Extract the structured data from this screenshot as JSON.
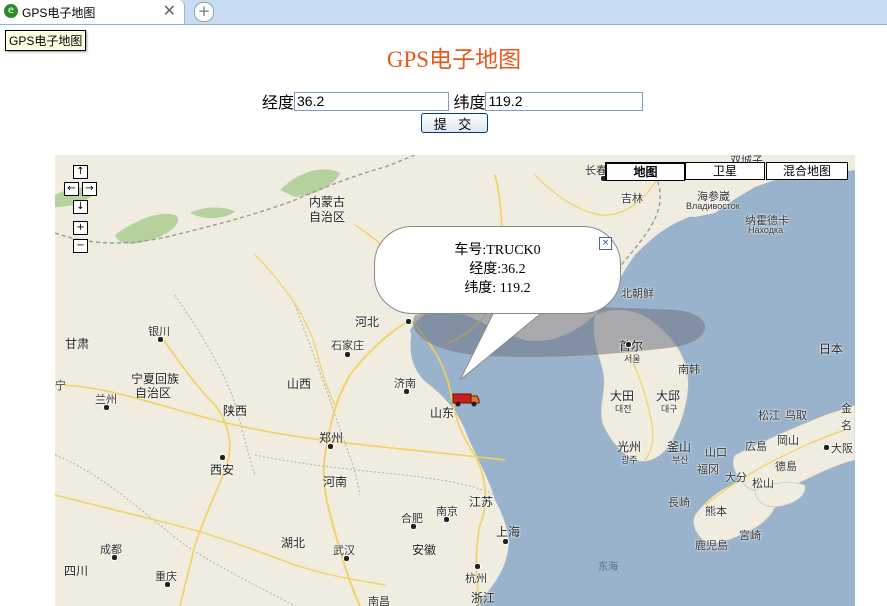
{
  "browser": {
    "tab_title": "GPS电子地图",
    "close_glyph": "✕",
    "new_tab_glyph": "+",
    "favicon": "e-icon",
    "tooltip": "GPS电子地图"
  },
  "page": {
    "heading": "GPS电子地图",
    "heading_color": "#e55a1c"
  },
  "form": {
    "lng_label": "经度",
    "lng_value": "36.2",
    "lat_label": "纬度",
    "lat_value": "119.2",
    "submit_label": "提 交"
  },
  "map": {
    "controls": {
      "up": "↑",
      "left": "←",
      "right": "→",
      "down": "↓",
      "zoom_in": "+",
      "zoom_out": "−"
    },
    "map_types": [
      "地图",
      "卫星",
      "混合地图"
    ],
    "active_map_type": "地图",
    "info_window": {
      "line1": "车号:TRUCK0",
      "line2": "经度:36.2",
      "line3": "纬度: 119.2",
      "close_glyph": "×"
    },
    "labels": {
      "changchun": "长春",
      "shuangchengzi": "双城子",
      "jilin": "吉林",
      "vladivostok_cn": "海参崴",
      "vladivostok": "Владивосток",
      "nakhodka_cn": "纳霍德卡",
      "nakhodka": "Находка",
      "inner_mongolia_1": "内蒙古",
      "inner_mongolia_2": "自治区",
      "north_korea": "北朝鲜",
      "hebei": "河北",
      "gansu": "甘肃",
      "yinchuan": "银川",
      "shijiazhuang": "石家庄",
      "shanxi": "山西",
      "jinan": "济南",
      "seoul_cn": "首尔",
      "seoul_kr": "서울",
      "nanbu": "南韩",
      "japan": "日本",
      "ning": "宁",
      "ningxia_1": "宁夏回族",
      "ningxia_2": "自治区",
      "lanzhou": "兰州",
      "shaanxi": "陕西",
      "shandong": "山东",
      "daejeon_cn": "大田",
      "daejeon_kr": "대전",
      "daegu_cn": "大邱",
      "daegu_kr": "대구",
      "matsue": "松江",
      "tottori": "鸟取",
      "kanazawa": "金",
      "na": "名",
      "zhengzhou": "郑州",
      "gwangju_cn": "光州",
      "gwangju_kr": "광주",
      "busan_cn": "釜山",
      "busan_kr": "부산",
      "yamaguchi": "山口",
      "hiroshima": "広島",
      "okayama": "岡山",
      "osaka": "大阪",
      "xian": "西安",
      "fukuoka": "福冈",
      "oita": "大分",
      "tokushima": "德島",
      "matsuyama": "松山",
      "henan": "河南",
      "jiangsu": "江苏",
      "nagasaki": "長崎",
      "kumamoto": "熊本",
      "hefei": "合肥",
      "nanjing": "南京",
      "shanghai": "上海",
      "miyazaki": "宮崎",
      "kagoshima": "鹿児島",
      "chengdu": "成都",
      "hubei": "湖北",
      "wuhan": "武汉",
      "anhui": "安徽",
      "donghai": "东海",
      "sichuan": "四川",
      "chongqing": "重庆",
      "hangzhou": "杭州",
      "nanchang": "南昌",
      "zhejiang": "浙江"
    },
    "colors": {
      "land": "#f0ece0",
      "sea": "#99b3cc",
      "park": "#b5d29c",
      "road": "#f6cf59",
      "border": "#9a9a9a"
    }
  }
}
